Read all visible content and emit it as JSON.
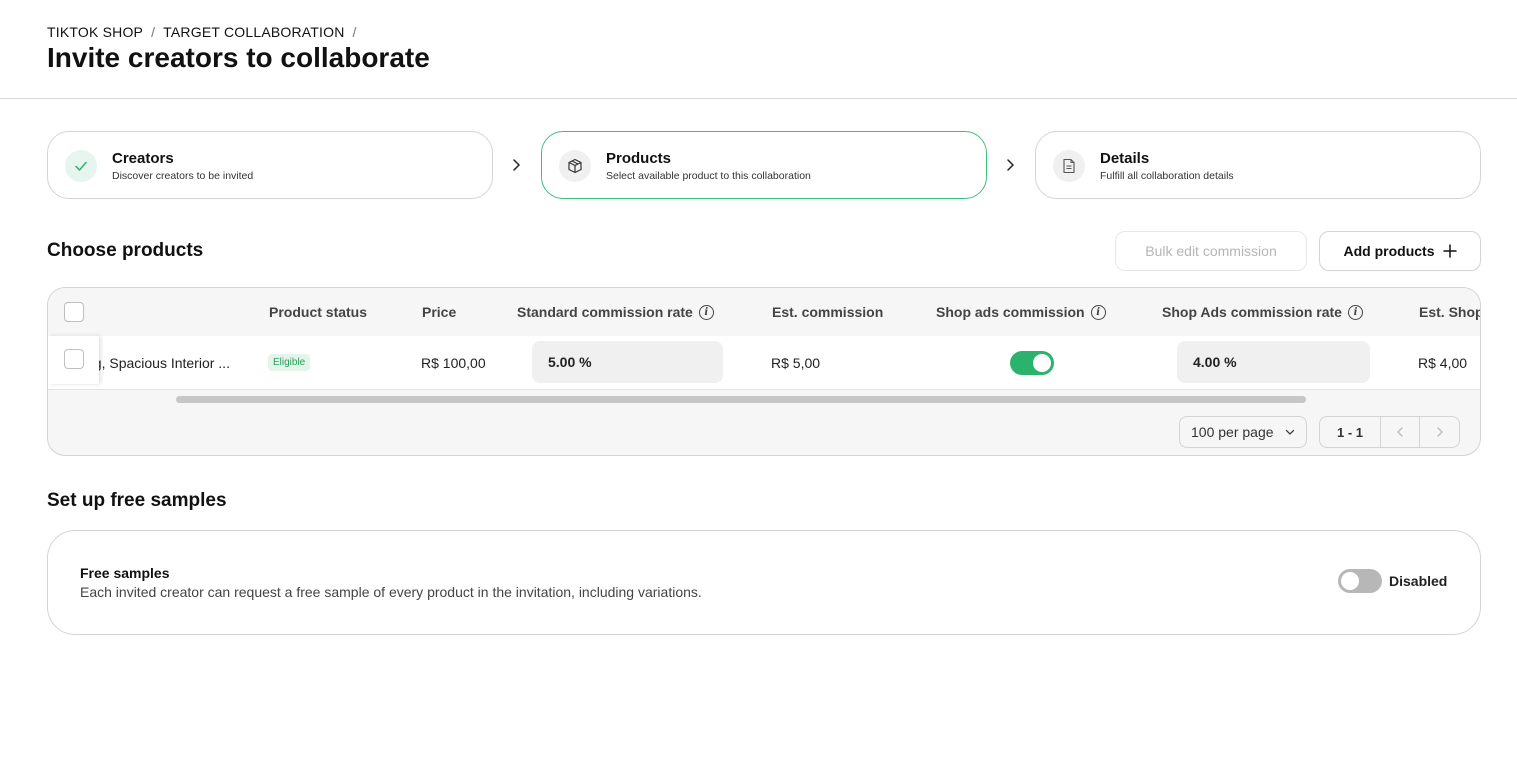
{
  "breadcrumb": {
    "items": [
      "TIKTOK SHOP",
      "TARGET COLLABORATION"
    ],
    "separator": "/"
  },
  "page_title": "Invite creators to collaborate",
  "steps": [
    {
      "title": "Creators",
      "subtitle": "Discover creators to be invited",
      "icon": "check-icon",
      "state": "done"
    },
    {
      "title": "Products",
      "subtitle": "Select available product to this collaboration",
      "icon": "box-icon",
      "state": "active"
    },
    {
      "title": "Details",
      "subtitle": "Fulfill all collaboration details",
      "icon": "document-icon",
      "state": "pending"
    }
  ],
  "products_section": {
    "title": "Choose products",
    "bulk_edit_label": "Bulk edit commission",
    "add_products_label": "Add products",
    "columns": {
      "product_status": "Product status",
      "price": "Price",
      "standard_rate": "Standard commission rate",
      "est_commission": "Est. commission",
      "shop_ads_commission": "Shop ads commission",
      "shop_ads_rate": "Shop Ads commission rate",
      "est_shop": "Est. Shop"
    },
    "rows": [
      {
        "product_name": "ag, Spacious Interior ...",
        "status": "Eligible",
        "price": "R$ 100,00",
        "standard_rate": "5.00 %",
        "est_commission": "R$ 5,00",
        "shop_ads_enabled": true,
        "shop_ads_rate": "4.00 %",
        "est_shop": "R$ 4,00"
      }
    ],
    "pagination": {
      "per_page": "100 per page",
      "range": "1 - 1"
    }
  },
  "samples_section": {
    "title": "Set up free samples",
    "card_title": "Free samples",
    "card_description": "Each invited creator can request a free sample of every product in the invitation, including variations.",
    "toggle_state_label": "Disabled",
    "enabled": false
  },
  "colors": {
    "accent_green": "#2bb26c",
    "border": "#d4d4d4",
    "badge_bg": "#e3f5ea"
  }
}
